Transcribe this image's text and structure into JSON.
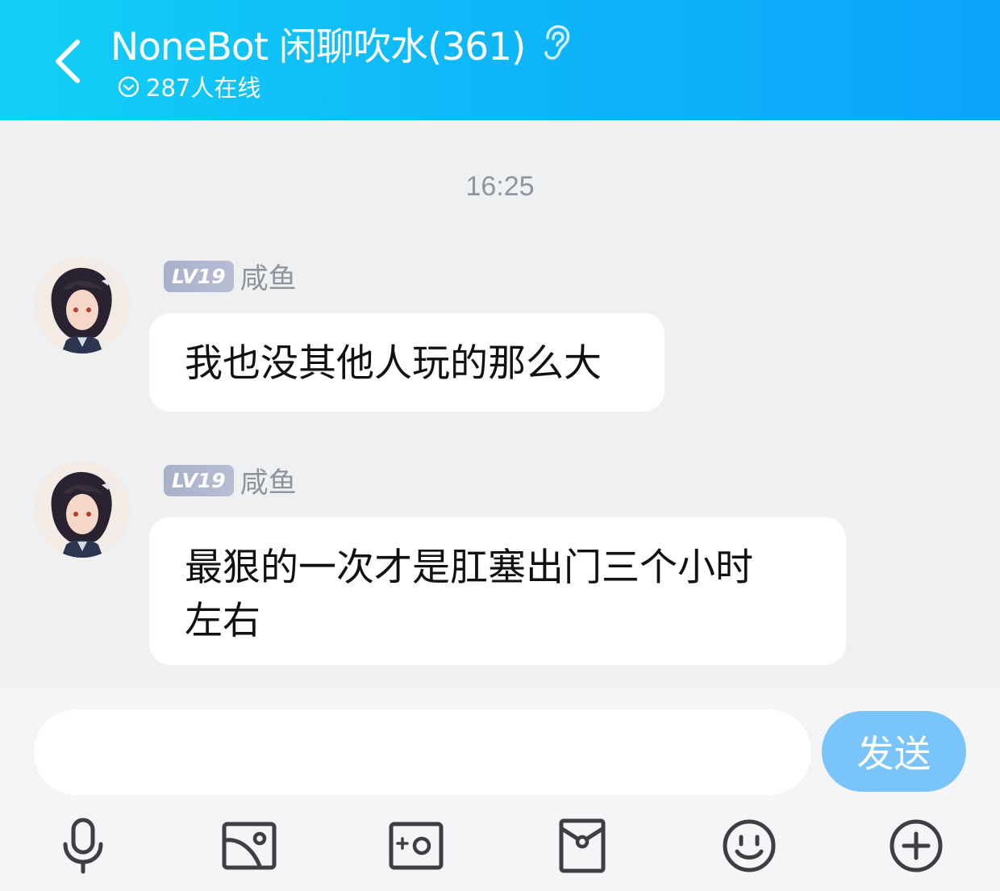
{
  "header": {
    "title": "NoneBot 闲聊吹水(361)",
    "online": "287人在线"
  },
  "chat": {
    "timestamp": "16:25",
    "messages": [
      {
        "level": "LV19",
        "sender": "咸鱼",
        "line1": "我也没其他人玩的那么大",
        "line2": ""
      },
      {
        "level": "LV19",
        "sender": "咸鱼",
        "line1": "最狠的一次才是肛塞出门三个小时",
        "line2": "左右"
      }
    ]
  },
  "input": {
    "value": "",
    "placeholder": "",
    "send_label": "发送"
  },
  "toolbar": {
    "items": [
      "microphone-icon",
      "image-icon",
      "camera-icon",
      "red-packet-icon",
      "emoji-icon",
      "plus-icon"
    ]
  },
  "colors": {
    "header_start": "#12d0f6",
    "header_end": "#0ba4fb",
    "send_button": "#79c5fb",
    "chat_bg": "#eff0f2"
  }
}
